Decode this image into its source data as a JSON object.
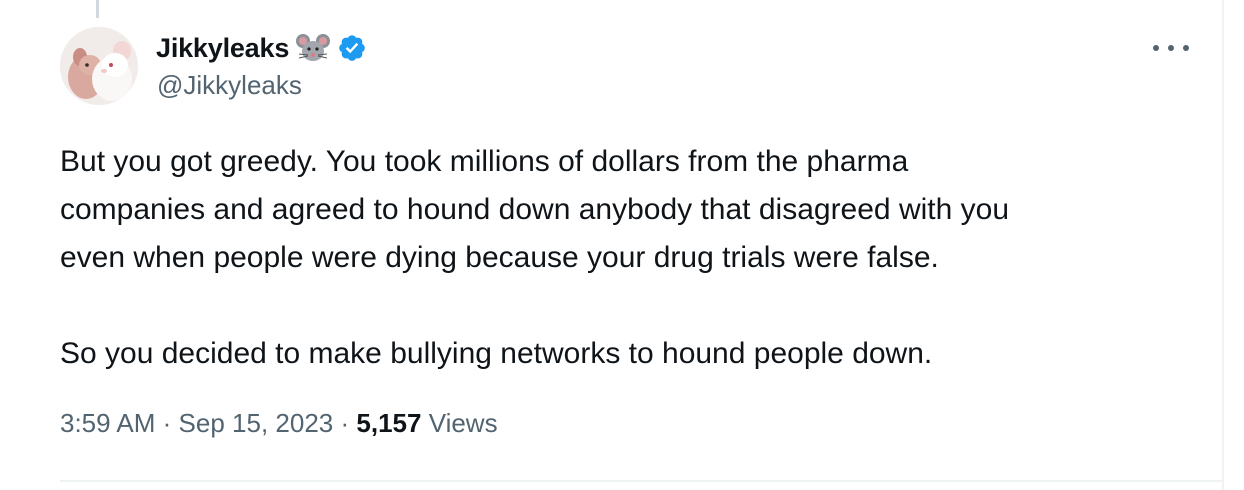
{
  "tweet": {
    "display_name": "Jikkyleaks",
    "handle": "@Jikkyleaks",
    "name_emoji_icon": "mouse-face-icon",
    "verified_icon": "verified-badge-icon",
    "more_icon": "more-options-icon",
    "accent_color": "#1d9bf0",
    "text_paragraphs": [
      [
        "But you got greedy. You took millions of dollars from the pharma",
        "companies and agreed to hound down anybody that disagreed with you",
        "even when people were dying because your drug trials were false."
      ],
      [
        "So you decided to make bullying networks to hound people down."
      ]
    ],
    "time": "3:59 AM",
    "separator": "·",
    "date": "Sep 15, 2023",
    "views_count": "5,157",
    "views_label": "Views"
  }
}
